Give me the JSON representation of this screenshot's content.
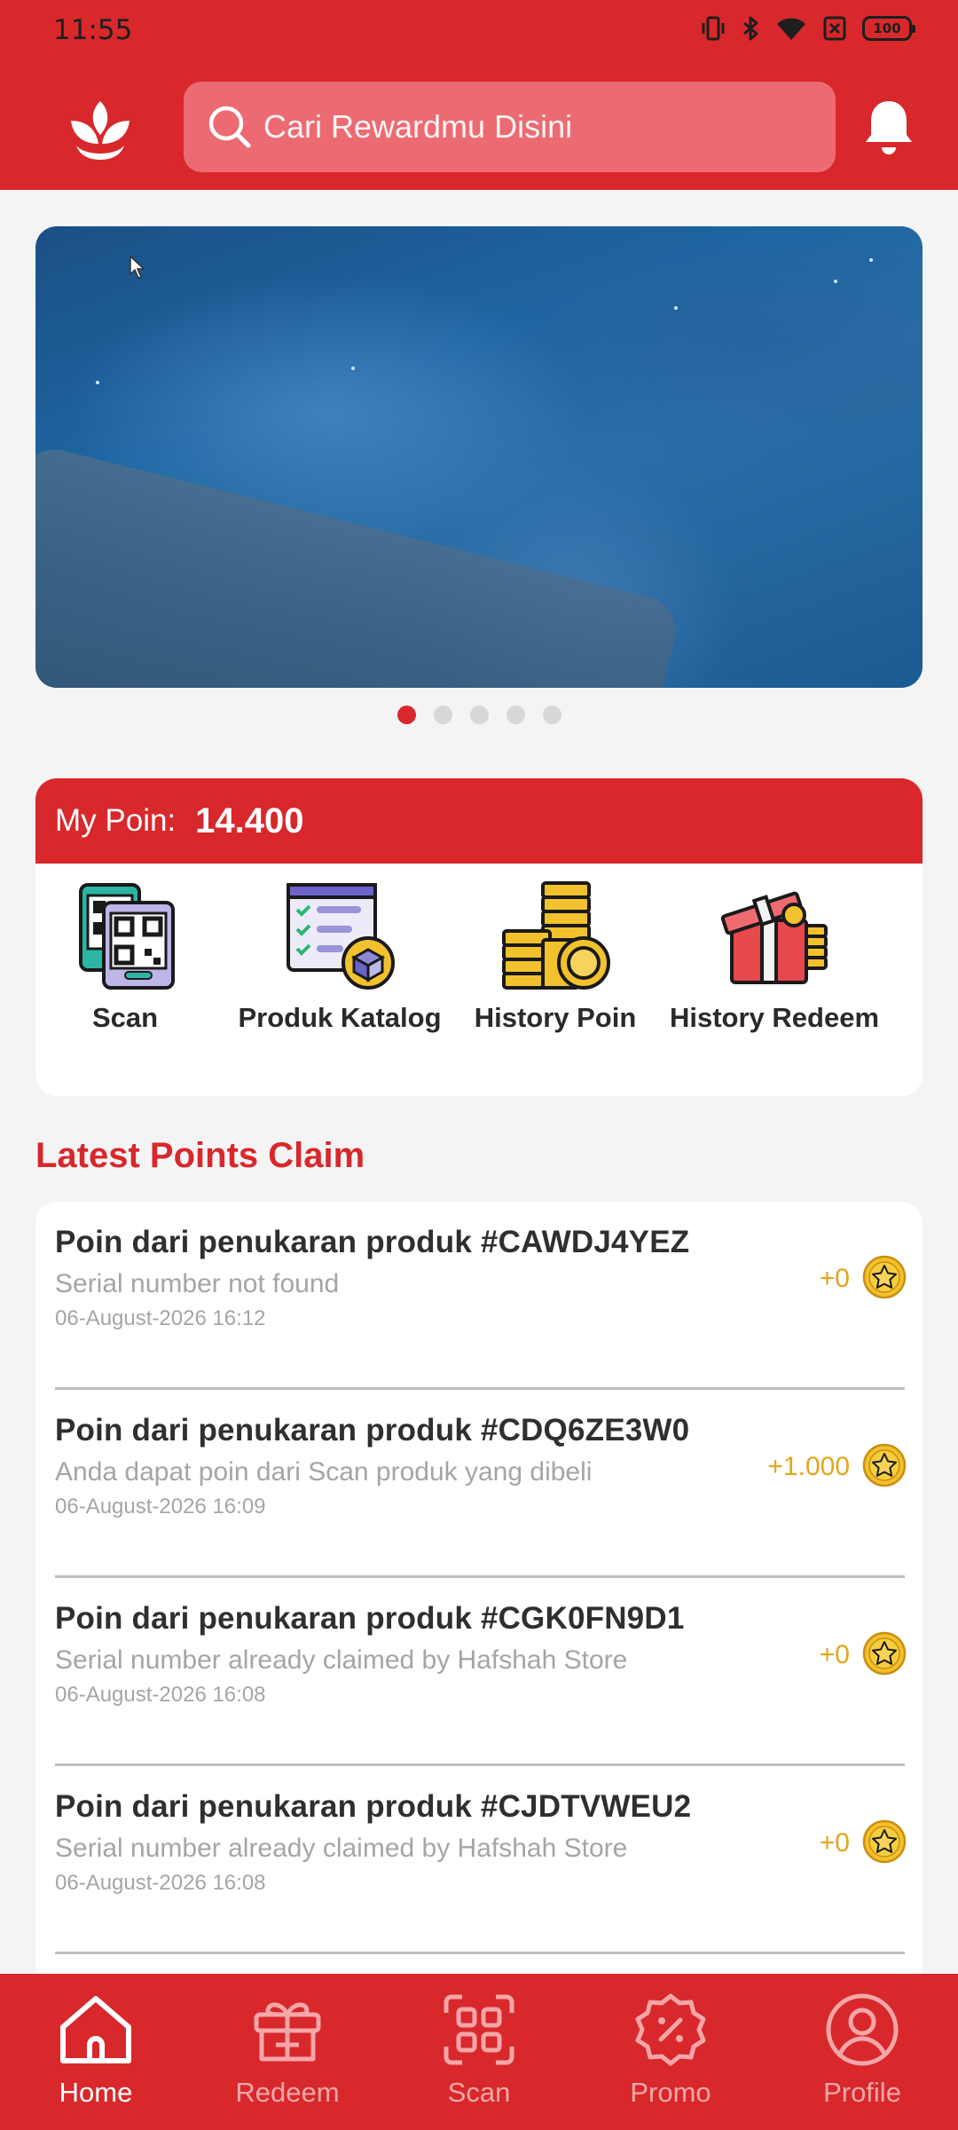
{
  "status_bar": {
    "time": "11:55",
    "battery": "100"
  },
  "header": {
    "logo": "leaf-logo-icon",
    "search_placeholder": "Cari Rewardmu Disini",
    "notification_icon": "bell-icon"
  },
  "banner": {
    "slides": 5,
    "active_slide": 1
  },
  "points": {
    "label": "My Poin:",
    "value": "14.400",
    "menu": [
      {
        "label": "Scan",
        "icon": "qr-scan-icon"
      },
      {
        "label": "Produk Katalog",
        "icon": "catalog-checklist-icon"
      },
      {
        "label": "History Poin",
        "icon": "coin-stack-icon"
      },
      {
        "label": "History Redeem",
        "icon": "gift-box-icon"
      }
    ]
  },
  "latest_claims": {
    "title": "Latest Points Claim",
    "items": [
      {
        "title": "Poin dari penukaran produk #CAWDJ4YEZ",
        "desc": "Serial number not found",
        "date": "06-August-2026 16:12",
        "points": "+0"
      },
      {
        "title": "Poin dari penukaran produk #CDQ6ZE3W0",
        "desc": "Anda dapat poin dari Scan produk yang dibeli",
        "date": "06-August-2026 16:09",
        "points": "+1.000"
      },
      {
        "title": "Poin dari penukaran produk #CGK0FN9D1",
        "desc": "Serial number already claimed by Hafshah Store",
        "date": "06-August-2026 16:08",
        "points": "+0"
      },
      {
        "title": "Poin dari penukaran produk #CJDTVWEU2",
        "desc": "Serial number already claimed by Hafshah Store",
        "date": "06-August-2026 16:08",
        "points": "+0"
      }
    ]
  },
  "bottom_nav": {
    "items": [
      {
        "label": "Home",
        "icon": "home-icon",
        "active": true
      },
      {
        "label": "Redeem",
        "icon": "gift-icon"
      },
      {
        "label": "Scan",
        "icon": "scan-icon"
      },
      {
        "label": "Promo",
        "icon": "promo-badge-icon"
      },
      {
        "label": "Profile",
        "icon": "profile-icon"
      }
    ]
  },
  "colors": {
    "primary": "#d8282b",
    "search_bg": "#ec6b72",
    "points_gold": "#e3a61c",
    "nav_inactive": "#f4a6a8",
    "muted_text": "#a5a5a5"
  }
}
